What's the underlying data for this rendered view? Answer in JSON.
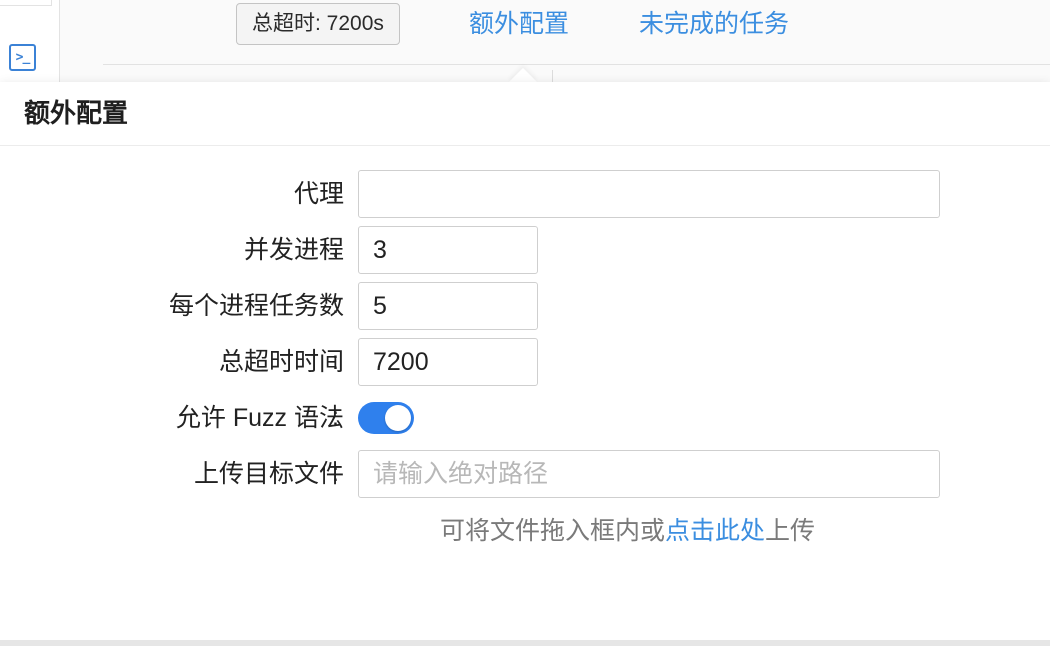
{
  "top_bar": {
    "timeout_tag": "总超时: 7200s",
    "extra_config_link": "额外配置",
    "unfinished_tasks_link": "未完成的任务"
  },
  "side": {
    "terminal_icon_glyph": ">_"
  },
  "popover": {
    "title": "额外配置",
    "fields": {
      "proxy": {
        "label": "代理",
        "colon": ":",
        "value": ""
      },
      "concurrency": {
        "label": "并发进程",
        "colon": ":",
        "value": "3"
      },
      "tasks_per_process": {
        "label": "每个进程任务数",
        "colon": ":",
        "value": "5"
      },
      "total_timeout": {
        "label": "总超时时间",
        "colon": ":",
        "value": "7200"
      },
      "allow_fuzz": {
        "label": "允许 Fuzz 语法",
        "colon": ":",
        "enabled": true
      },
      "upload_target": {
        "label": "上传目标文件",
        "colon": ":",
        "placeholder": "请输入绝对路径"
      }
    },
    "upload_hint": {
      "prefix": "可将文件拖入框内或",
      "link": "点击此处",
      "suffix": "上传"
    }
  },
  "colors": {
    "accent": "#3b8ee0",
    "toggle_on": "#2f80ed"
  }
}
